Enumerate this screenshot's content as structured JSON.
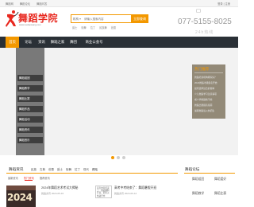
{
  "topbar": {
    "links": [
      "舞蹈网",
      "舞蹈论坛",
      "舞蹈问答"
    ],
    "login": "登录 | 注册"
  },
  "header": {
    "logo_text": "舞蹈学院",
    "logo_domain": "www.wudaowang.com",
    "search": {
      "type_label": "机构",
      "placeholder": "请输入搜索内容",
      "button_label": "立即查询"
    },
    "hotwords": [
      "爵士",
      "街舞",
      "拉丁",
      "民族舞",
      "芭蕾"
    ],
    "phone": "077-5155-8025",
    "phone2": "24h热线"
  },
  "nav": {
    "items": [
      {
        "label": "首页",
        "active": true
      },
      {
        "label": "论坛",
        "active": false
      },
      {
        "label": "资讯",
        "active": false
      },
      {
        "label": "舞蹈之家",
        "active": false
      },
      {
        "label": "舞团",
        "active": false
      },
      {
        "label": "商业公会号",
        "active": false
      }
    ]
  },
  "side_menu": {
    "items": [
      "舞蹈组团",
      "舞蹈教学",
      "舞蹈比赛",
      "舞蹈作品",
      "舞蹈活动",
      "舞蹈资讯",
      "舞蹈音乐"
    ]
  },
  "notice": {
    "title": "热门推荐",
    "items": [
      "舞蹈培训机构哪家好？",
      "2024舞蹈考级报名开始",
      "如何选择适合的舞种",
      "少儿舞蹈学习注意事项",
      "成人学舞蹈晚不晚",
      "舞蹈比赛报名指南",
      "暑期舞蹈班火热招生"
    ]
  },
  "carousel": {
    "count": 3,
    "active_index": 0
  },
  "news": {
    "label": "舞蹈资讯",
    "tabs": [
      "民族",
      "古典",
      "芭蕾",
      "爵士",
      "街舞",
      "拉丁",
      "现代",
      "踢踏"
    ],
    "sub_tabs": [
      "最新资讯",
      "热门资讯",
      "推荐资讯"
    ],
    "active_sub": 1,
    "thumb_text": "2024",
    "items": [
      {
        "title": "2024年舞蹈艺术考试大揭秘",
        "meta": "舞蹈资讯  2024-05-16",
        "image_caption": ""
      },
      {
        "title": "高考中考结束了：舞蹈暑假开班",
        "meta": "舞蹈资讯  2024-06-12",
        "image_caption": "高考中考结束了：舞蹈暑假开班，招生火热进行中"
      }
    ]
  },
  "sidebar": {
    "label": "舞蹈论坛",
    "items": [
      "舞蹈组团",
      "舞蹈爱好",
      "舞蹈教学",
      "舞蹈比赛"
    ]
  },
  "colors": {
    "accent": "#f39800",
    "brand": "#e8281f",
    "nav_bg": "#2a3036"
  }
}
